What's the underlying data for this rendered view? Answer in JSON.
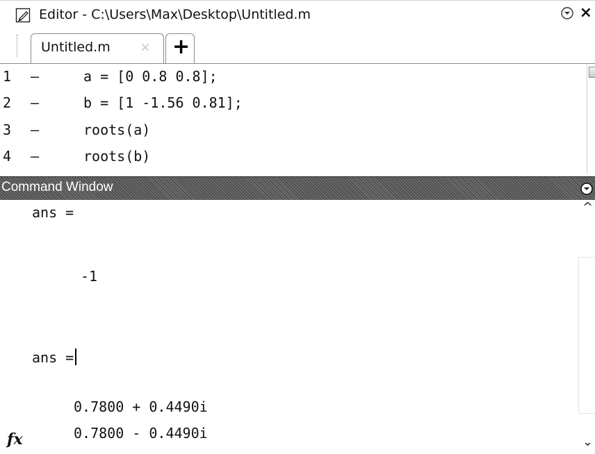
{
  "editor": {
    "title": "Editor - C:\\Users\\Max\\Desktop\\Untitled.m",
    "close_glyph": "×",
    "tabs": [
      {
        "label": "Untitled.m",
        "close_glyph": "×"
      }
    ],
    "add_tab_glyph": "+",
    "lines": [
      {
        "number": "1",
        "marker": "–",
        "code": "a = [0 0.8 0.8];"
      },
      {
        "number": "2",
        "marker": "–",
        "code": "b = [1 -1.56 0.81];"
      },
      {
        "number": "3",
        "marker": "–",
        "code": "roots(a)"
      },
      {
        "number": "4",
        "marker": "–",
        "code": "roots(b)"
      }
    ]
  },
  "command_window": {
    "title": "Command Window",
    "output": [
      {
        "text": "ans ="
      },
      {
        "text": "-1"
      },
      {
        "text": "ans ="
      },
      {
        "text": "0.7800 + 0.4490i"
      },
      {
        "text": "0.7800 - 0.4490i"
      }
    ],
    "prompt_label": "fx",
    "scroll_up_glyph": "^",
    "scroll_down_glyph": "⌄"
  },
  "icons": {
    "editor": "pencil-page-icon",
    "collapse": "circle-chevron-down-icon",
    "close": "close-icon"
  },
  "colors": {
    "header_dark": "#3e3e3e",
    "header_light": "#6e6e6e",
    "header_text": "#ffffff",
    "tab_border": "#8a8a8a"
  }
}
